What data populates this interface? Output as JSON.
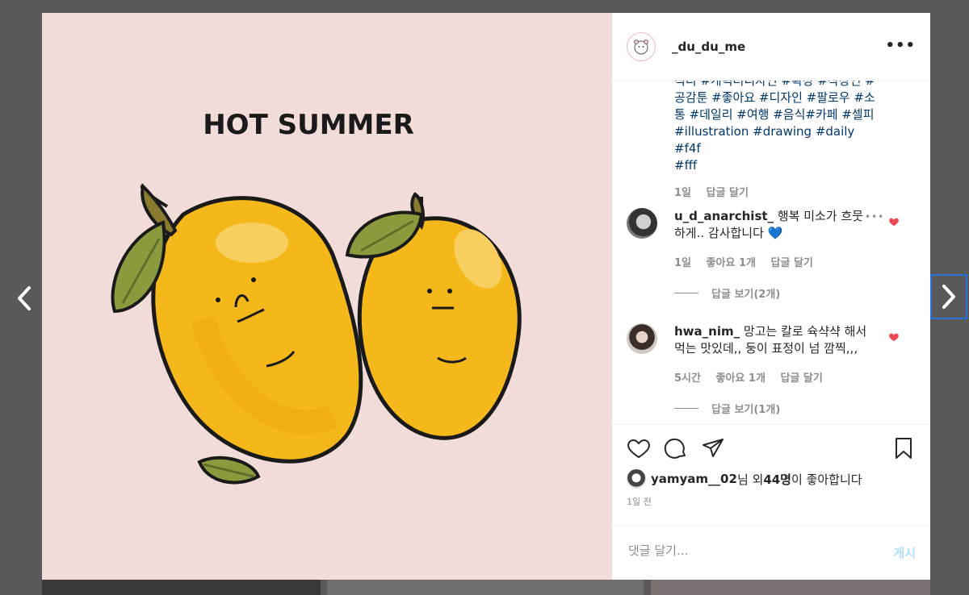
{
  "post": {
    "username": "_du_du_me",
    "more_icon": "more-horizontal-icon",
    "image_title": "HOT SUMMER",
    "caption_lines": [
      "직디 #개럭터디자인 #확장 #작장인 #",
      "공감툰 #좋아요 #디자인 #팔로우 #소",
      "통 #데일리 #여행 #음식#카페 #셀피",
      "#illustration #drawing #daily #f4f",
      "#fff"
    ],
    "caption_time": "1일",
    "caption_reply": "답글 달기"
  },
  "comments": [
    {
      "user": "u_d_anarchist_",
      "text": "행복 미소가 흐뭇하게.. 감사합니다 💙",
      "time": "1일",
      "likes": "좋아요 1개",
      "reply": "답글 달기",
      "view_replies": "답글 보기(2개)"
    },
    {
      "user": "hwa_nim_",
      "text": "망고는 칼로 슉샥샥 해서 먹는 맛있데,, 둥이 표정이 넘 깜찍,,,",
      "time": "5시간",
      "likes": "좋아요 1개",
      "reply": "답글 달기",
      "view_replies": "답글 보기(1개)"
    }
  ],
  "likes": {
    "user": "yamyam__02",
    "suffix1": "님 외 ",
    "count": "44명",
    "suffix2": "이 좋아합니다"
  },
  "date": "1일 전",
  "comment_input": {
    "placeholder": "댓글 달기...",
    "value": ""
  },
  "post_button": "게시",
  "colors": {
    "accent": "#0095f6",
    "heart": "#ed4956",
    "hashtag": "#00376b",
    "mango": "#f5b81a"
  }
}
